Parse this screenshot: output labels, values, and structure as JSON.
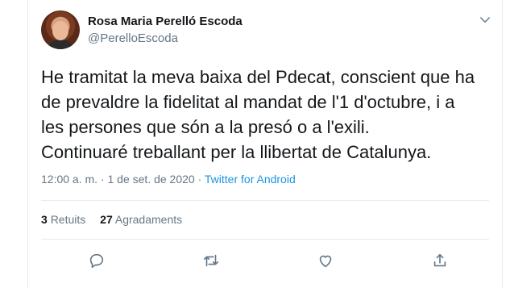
{
  "tweet": {
    "author_name": "Rosa Maria Perelló Escoda",
    "author_handle": "@PerelloEscoda",
    "text": "He tramitat la meva baixa del Pdecat, conscient que ha\nde prevaldre la fidelitat al mandat de l'1 d'octubre, i a\nles persones que són a la presó o a l'exili.\nContinuaré treballant per la llibertat de Catalunya.",
    "time": "12:00 a. m.",
    "separator": "·",
    "date": "1 de set. de 2020",
    "source": "Twitter for Android"
  },
  "stats": {
    "retweets_count": "3",
    "retweets_label": "Retuits",
    "likes_count": "27",
    "likes_label": "Agradaments"
  },
  "icons": {
    "menu": "chevron-down-icon",
    "reply": "reply-icon",
    "retweet": "retweet-icon",
    "like": "heart-icon",
    "share": "share-icon"
  },
  "colors": {
    "text": "#14171a",
    "secondary": "#657786",
    "link": "#1b95e0",
    "border": "#e6ecf0"
  }
}
